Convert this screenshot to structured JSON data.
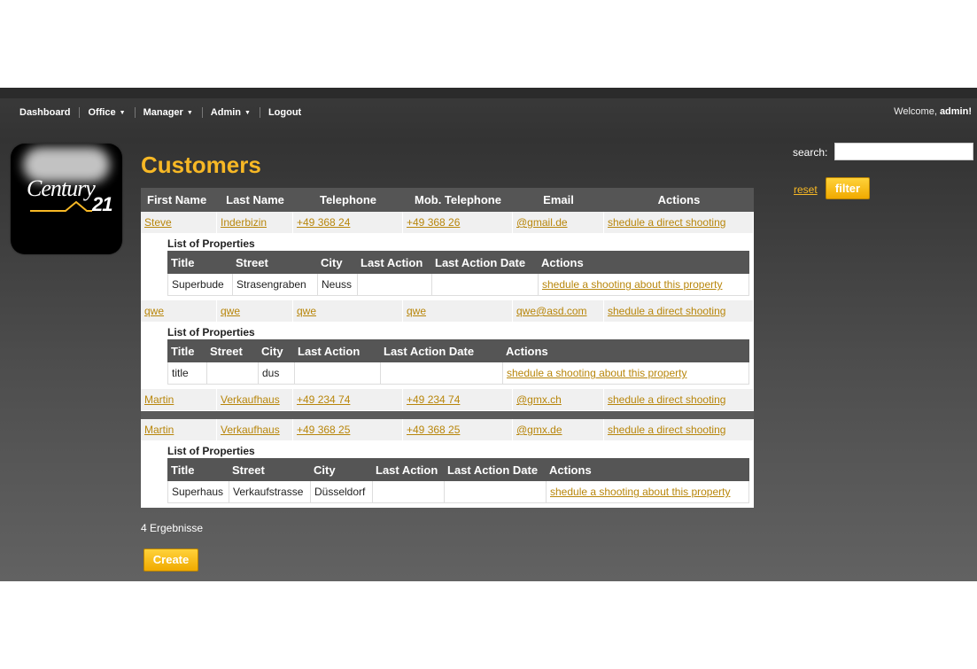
{
  "nav": {
    "items": [
      {
        "label": "Dashboard",
        "dropdown": false
      },
      {
        "label": "Office",
        "dropdown": true
      },
      {
        "label": "Manager",
        "dropdown": true
      },
      {
        "label": "Admin",
        "dropdown": true
      },
      {
        "label": "Logout",
        "dropdown": false
      }
    ],
    "welcome_prefix": "Welcome,",
    "welcome_user": "admin!"
  },
  "logo": {
    "text": "Century",
    "number": "21"
  },
  "page": {
    "title": "Customers"
  },
  "search": {
    "label": "search:",
    "value": "",
    "reset_label": "reset",
    "filter_label": "filter"
  },
  "customers_table": {
    "headers": [
      "First Name",
      "Last Name",
      "Telephone",
      "Mob. Telephone",
      "Email",
      "Actions"
    ],
    "property_list_title": "List of Properties",
    "rows": [
      {
        "cells": [
          "Steve",
          "Inderbizin",
          "+49 368 24",
          "+49 368 26",
          "@gmail.de",
          "shedule a direct shooting"
        ],
        "properties": {
          "headers": [
            "Title",
            "Street",
            "City",
            "Last Action",
            "Last Action Date",
            "Actions"
          ],
          "rows": [
            [
              "Superbude",
              "Strasengraben",
              "Neuss",
              "",
              "",
              "shedule a shooting about this property"
            ]
          ]
        }
      },
      {
        "cells": [
          "qwe",
          "qwe",
          "qwe",
          "qwe",
          "qwe@asd.com",
          "shedule a direct shooting"
        ],
        "properties": {
          "headers": [
            "Title",
            "Street",
            "City",
            "Last Action",
            "Last Action Date",
            "Actions"
          ],
          "rows": [
            [
              "title",
              "",
              "dus",
              "",
              "",
              "shedule a shooting about this property"
            ]
          ]
        }
      },
      {
        "cells": [
          "Martin",
          "Verkaufhaus",
          "+49 234 74",
          "+49 234 74",
          "@gmx.ch",
          "shedule a direct shooting"
        ],
        "properties": null
      },
      {
        "cells": [
          "Martin",
          "Verkaufhaus",
          "+49 368 25",
          "+49 368 25",
          "@gmx.de",
          "shedule a direct shooting"
        ],
        "properties": {
          "headers": [
            "Title",
            "Street",
            "City",
            "Last Action",
            "Last Action Date",
            "Actions"
          ],
          "rows": [
            [
              "Superhaus",
              "Verkaufstrasse",
              "Düsseldorf",
              "",
              "",
              "shedule a shooting about this property"
            ]
          ]
        }
      }
    ]
  },
  "results_count": "4 Ergebnisse",
  "create_label": "Create",
  "colors": {
    "accent": "#f7b825",
    "link": "#b8860b",
    "header_bg": "#555555"
  }
}
